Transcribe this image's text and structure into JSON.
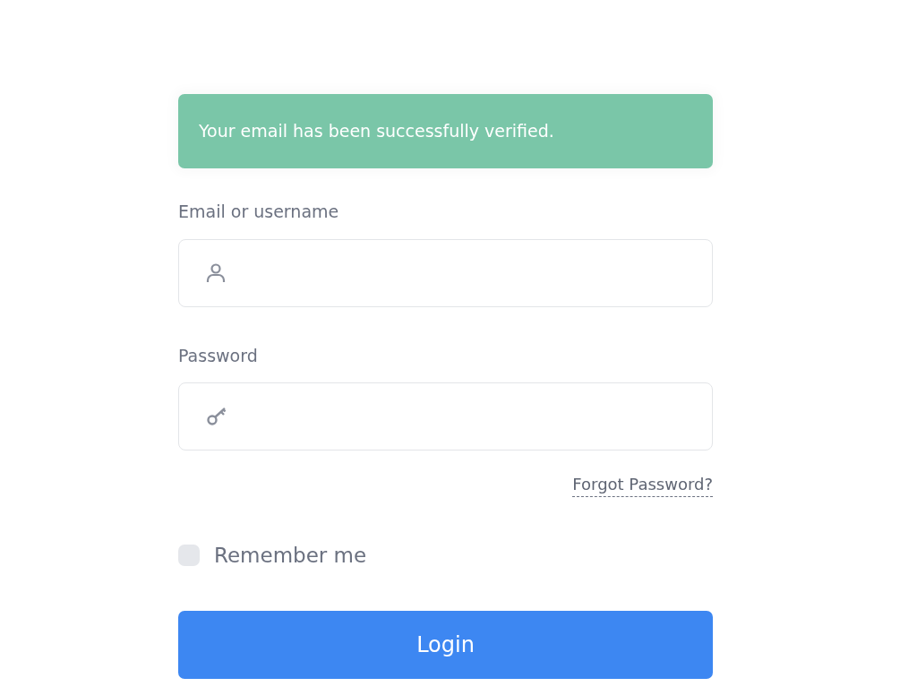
{
  "alert": {
    "text": "Your email has been successfully verified."
  },
  "fields": [
    {
      "label": "Email or username",
      "kind": "user"
    },
    {
      "label": "Password",
      "kind": "key"
    }
  ],
  "forgot_link": "Forgot Password?",
  "remember": {
    "label": "Remember me",
    "checked": false
  },
  "login_button": "Login"
}
